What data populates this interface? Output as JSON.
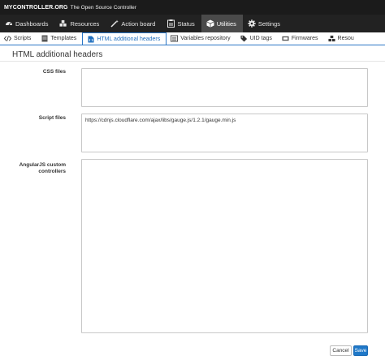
{
  "header": {
    "brand": "MYCONTROLLER.ORG",
    "tagline": "The Open Source Controller"
  },
  "mainnav": {
    "items": [
      {
        "label": "Dashboards",
        "icon": "dashboard-icon"
      },
      {
        "label": "Resources",
        "icon": "cubes-icon"
      },
      {
        "label": "Action board",
        "icon": "magic-wand-icon"
      },
      {
        "label": "Status",
        "icon": "clipboard-icon"
      },
      {
        "label": "Utilities",
        "icon": "cube-icon",
        "active": true
      },
      {
        "label": "Settings",
        "icon": "gear-icon"
      }
    ]
  },
  "subnav": {
    "tabs": [
      {
        "label": "Scripts",
        "icon": "code-icon"
      },
      {
        "label": "Templates",
        "icon": "file-icon"
      },
      {
        "label": "HTML additional headers",
        "icon": "file-code-icon",
        "active": true
      },
      {
        "label": "Variables repository",
        "icon": "list-icon"
      },
      {
        "label": "UID tags",
        "icon": "tags-icon"
      },
      {
        "label": "Firmwares",
        "icon": "firmware-icon"
      },
      {
        "label": "Resou",
        "icon": "resources-icon"
      }
    ]
  },
  "panel": {
    "title": "HTML additional headers"
  },
  "form": {
    "css_files_label": "CSS files",
    "css_files_value": "",
    "script_files_label": "Script files",
    "script_files_value": "https://cdnjs.cloudflare.com/ajax/libs/gauge.js/1.2.1/gauge.min.js",
    "angular_label": "AngularJS custom controllers",
    "angular_value": ""
  },
  "buttons": {
    "cancel": "Cancel",
    "save": "Save"
  },
  "colors": {
    "accent": "#1f78c8",
    "topbar": "#1b1b1b",
    "nav": "#222222",
    "nav_active": "#4a4a4a"
  }
}
